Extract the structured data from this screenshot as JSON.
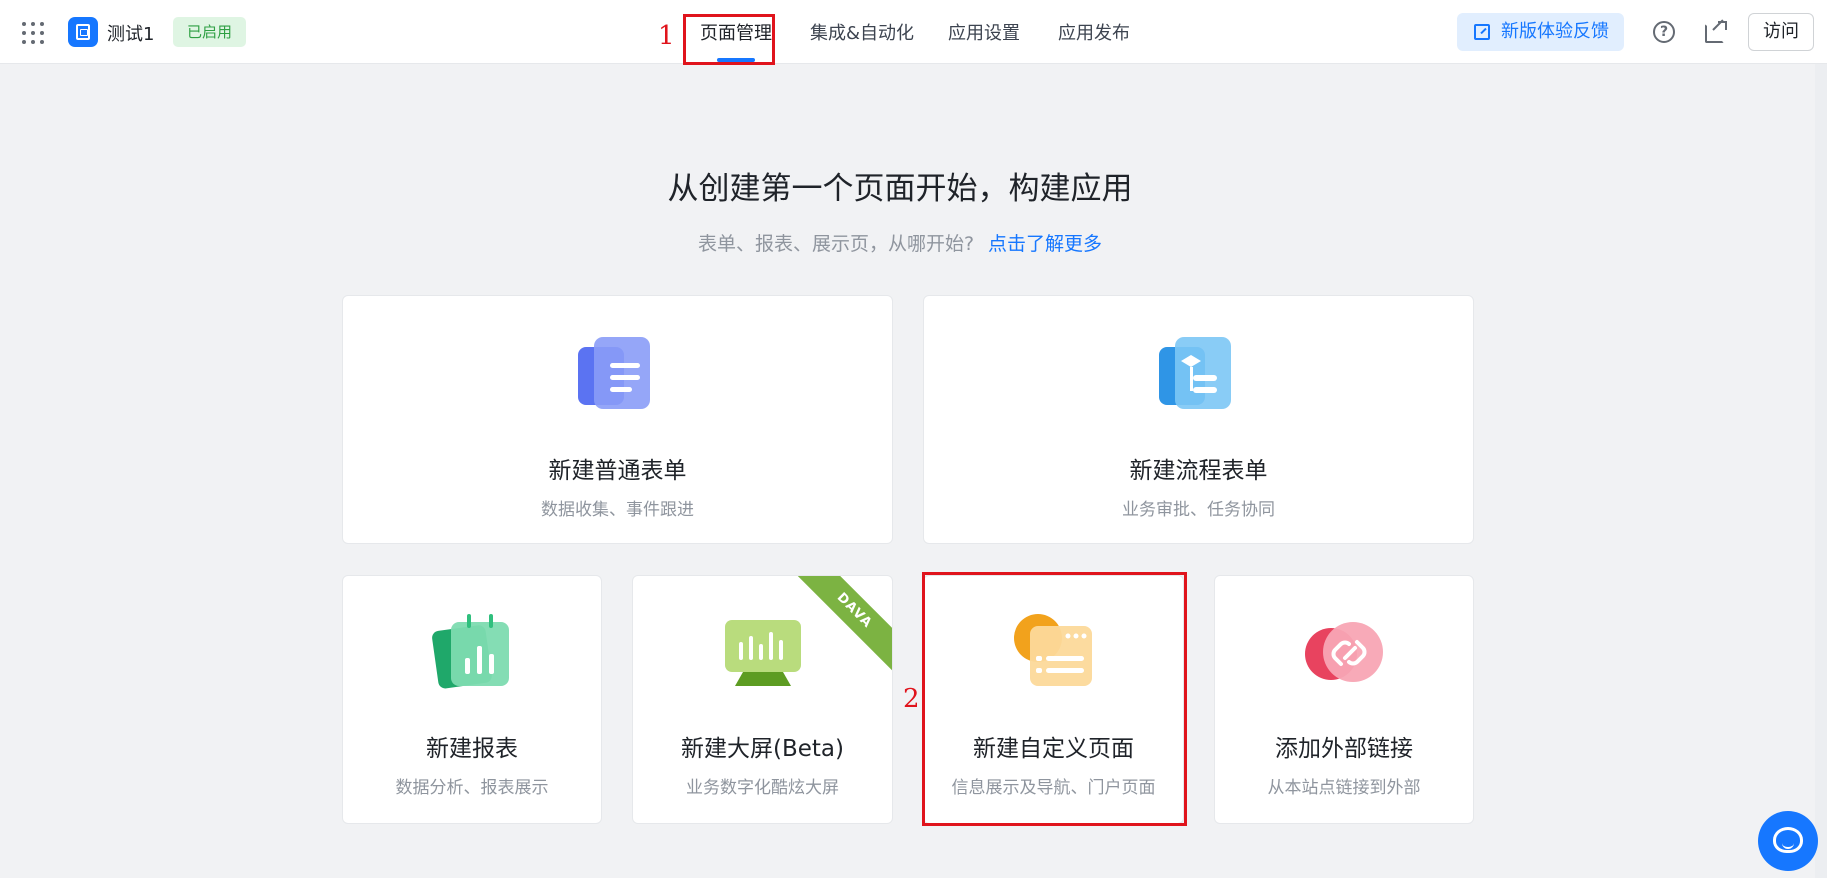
{
  "topbar": {
    "app_name": "测试1",
    "status_badge": "已启用",
    "nav": [
      "页面管理",
      "集成&自动化",
      "应用设置",
      "应用发布"
    ],
    "active_nav": "页面管理",
    "feedback_label": "新版体验反馈",
    "help_symbol": "?",
    "visit_label": "访问",
    "icons": [
      "app-grid-icon",
      "app-logo-icon",
      "help-icon",
      "external-link-icon",
      "edit-feedback-icon"
    ]
  },
  "annotations": {
    "marker1": "1",
    "marker2": "2",
    "color": "#e0141c"
  },
  "hero": {
    "title": "从创建第一个页面开始，构建应用",
    "subtitle": "表单、报表、展示页，从哪开始?",
    "learn_more": "点击了解更多"
  },
  "cards": [
    {
      "title": "新建普通表单",
      "desc": "数据收集、事件跟进",
      "icon": "form-document-icon",
      "color": "#5b73f2"
    },
    {
      "title": "新建流程表单",
      "desc": "业务审批、任务协同",
      "icon": "flow-form-icon",
      "color": "#3fa9ee"
    },
    {
      "title": "新建报表",
      "desc": "数据分析、报表展示",
      "icon": "report-chart-icon",
      "color": "#2fbf7d"
    },
    {
      "title": "新建大屏(Beta)",
      "desc": "业务数字化酷炫大屏",
      "icon": "big-screen-icon",
      "color": "#8bc34a",
      "ribbon": "DAVA"
    },
    {
      "title": "新建自定义页面",
      "desc": "信息展示及导航、门户页面",
      "icon": "custom-page-icon",
      "color": "#f5a623"
    },
    {
      "title": "添加外部链接",
      "desc": "从本站点链接到外部",
      "icon": "external-link-chain-icon",
      "color": "#f06482"
    }
  ],
  "colors": {
    "accent": "#1677ff",
    "badge_bg": "#dff5e3",
    "badge_text": "#2ea043",
    "page_bg": "#f1f2f4"
  },
  "floating": {
    "icon": "customer-service-icon"
  }
}
